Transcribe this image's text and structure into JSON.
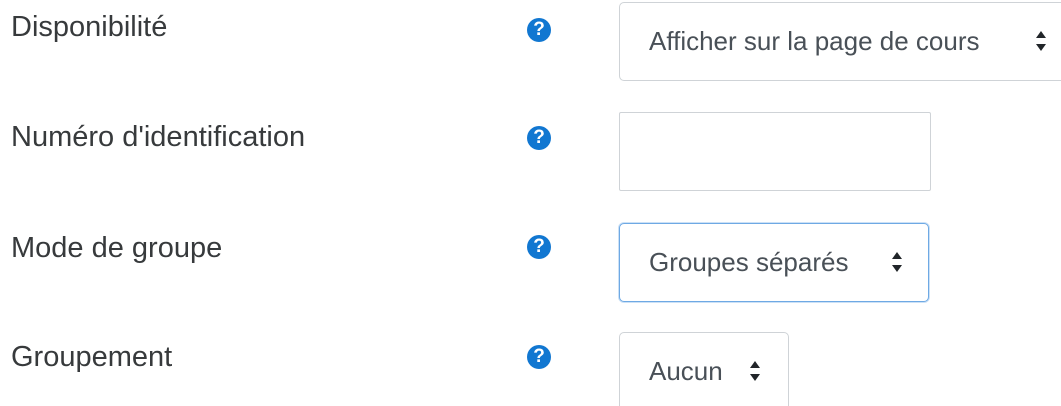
{
  "fields": [
    {
      "label": "Disponibilité",
      "control": "select",
      "value": "Afficher sur la page de cours",
      "help_icon": "question-circle-icon"
    },
    {
      "label": "Numéro d'identification",
      "control": "text",
      "value": "",
      "help_icon": "question-circle-icon"
    },
    {
      "label": "Mode de groupe",
      "control": "select",
      "value": "Groupes séparés",
      "focused": true,
      "help_icon": "question-circle-icon"
    },
    {
      "label": "Groupement",
      "control": "select",
      "value": "Aucun",
      "help_icon": "question-circle-icon"
    }
  ],
  "help_glyph": "?",
  "colors": {
    "help_icon": "#1177d1",
    "label_text": "#373a3c",
    "control_border": "#cfd3d7",
    "focus_border": "#6ea9e4"
  }
}
